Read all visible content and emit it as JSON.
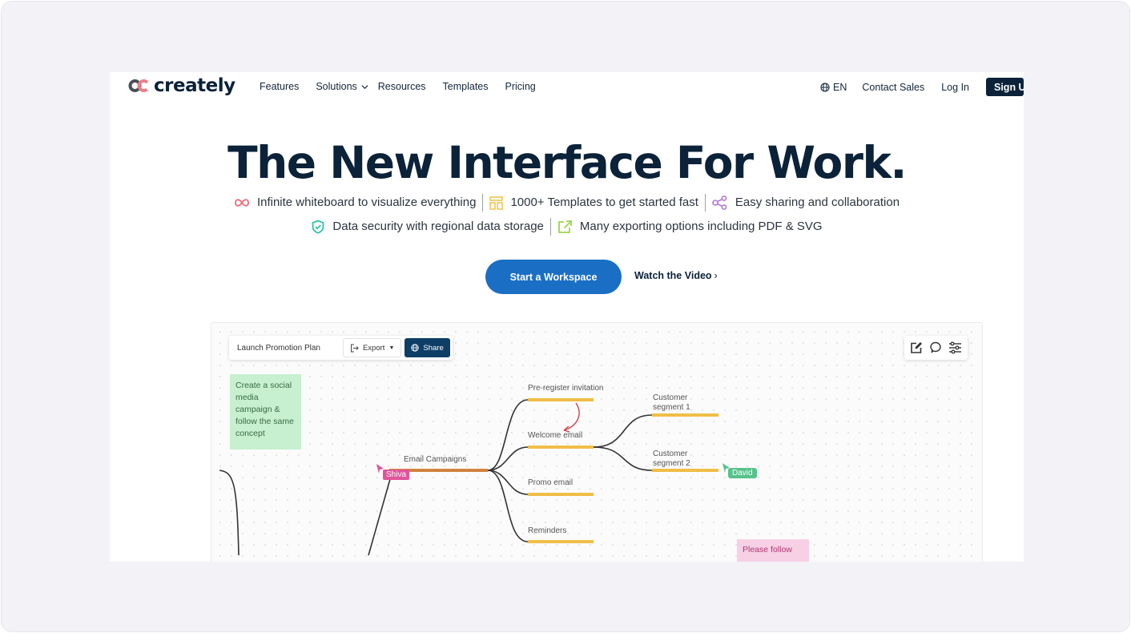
{
  "brand": {
    "name": "creately",
    "colors": {
      "navy": "#0b2239",
      "primary": "#1a6fc4",
      "share": "#0e3e66",
      "branch": "#f0be47",
      "root_branch": "#d4823f"
    }
  },
  "nav": {
    "items": [
      {
        "label": "Features"
      },
      {
        "label": "Solutions",
        "has_dropdown": true
      },
      {
        "label": "Resources"
      },
      {
        "label": "Templates"
      },
      {
        "label": "Pricing"
      }
    ],
    "language": "EN",
    "contact": "Contact Sales",
    "login": "Log In",
    "signup": "Sign Up"
  },
  "hero": {
    "title": "The New Interface For Work.",
    "features_row1": [
      {
        "icon": "infinity-icon",
        "text": "Infinite whiteboard to visualize everything"
      },
      {
        "icon": "template-icon",
        "text": "1000+ Templates to get started fast"
      },
      {
        "icon": "share-icon",
        "text": "Easy sharing and collaboration"
      }
    ],
    "features_row2": [
      {
        "icon": "shield-check-icon",
        "text": "Data security with regional data storage"
      },
      {
        "icon": "export-icon",
        "text": "Many exporting options including PDF & SVG"
      }
    ],
    "cta_primary": "Start a Workspace",
    "cta_secondary": "Watch the Video",
    "cta_secondary_arrow": "›"
  },
  "demo": {
    "doc_title": "Launch Promotion Plan",
    "export_label": "Export",
    "share_label": "Share",
    "sticky_green": "Create a social media campaign & follow the same concept",
    "sticky_pink": "Please follow",
    "root_node": "Email Campaigns",
    "branches": [
      {
        "label": "Pre-register invitation"
      },
      {
        "label": "Welcome email"
      },
      {
        "label": "Promo email"
      },
      {
        "label": "Reminders"
      }
    ],
    "sub_branches": [
      {
        "label": "Customer segment 1"
      },
      {
        "label": "Customer segment 2"
      }
    ],
    "cursors": [
      {
        "name": "Shiva",
        "color": "#e0559a"
      },
      {
        "name": "David",
        "color": "#56c28c"
      }
    ]
  }
}
